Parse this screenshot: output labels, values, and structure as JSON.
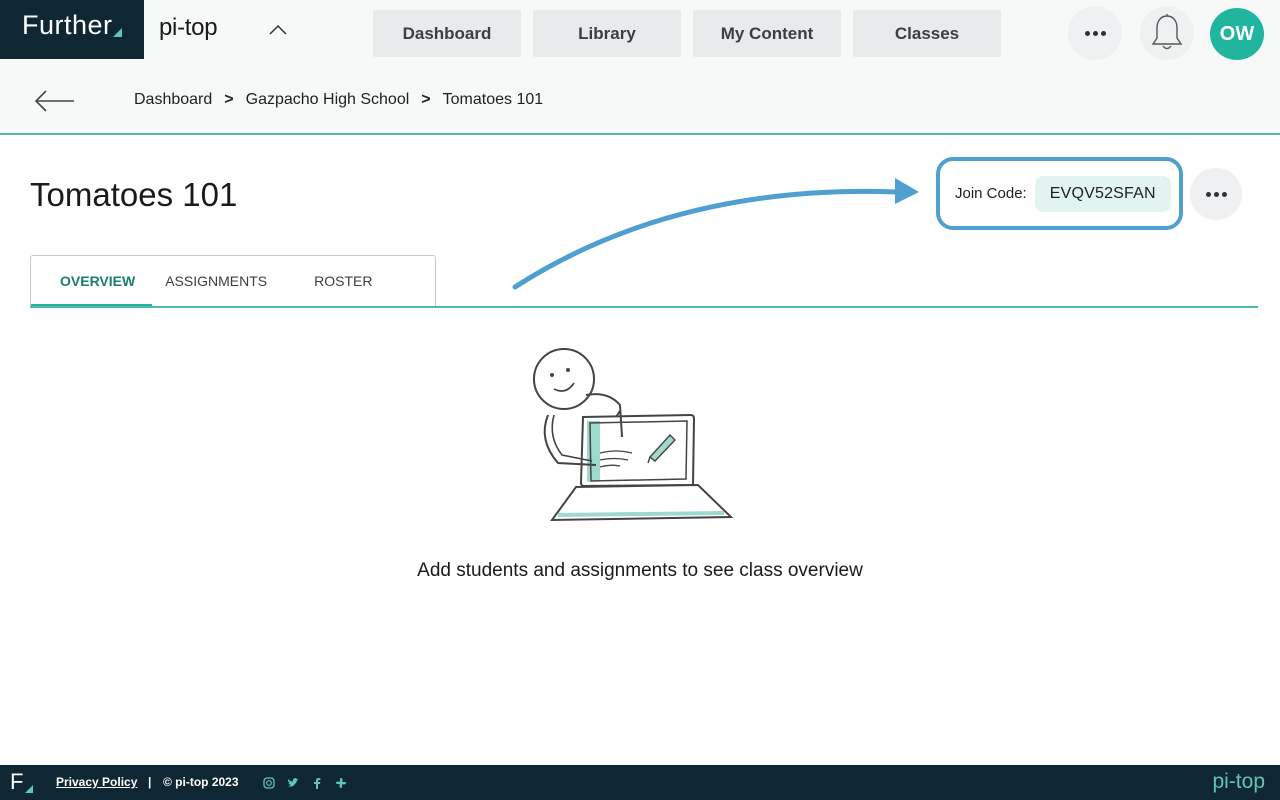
{
  "header": {
    "brand": "Further",
    "org_name": "pi-top",
    "nav": [
      {
        "label": "Dashboard"
      },
      {
        "label": "Library"
      },
      {
        "label": "My Content"
      },
      {
        "label": "Classes"
      }
    ],
    "avatar_initials": "OW"
  },
  "breadcrumb": [
    "Dashboard",
    "Gazpacho High School",
    "Tomatoes 101"
  ],
  "breadcrumb_separator": ">",
  "page": {
    "title": "Tomatoes 101",
    "join_code_label": "Join Code:",
    "join_code": "EVQV52SFAN"
  },
  "tabs": [
    {
      "label": "OVERVIEW",
      "active": true
    },
    {
      "label": "ASSIGNMENTS",
      "active": false
    },
    {
      "label": "ROSTER",
      "active": false
    }
  ],
  "empty_state": {
    "message": "Add students and assignments to see class overview",
    "illustration": "person-with-laptop-illustration"
  },
  "footer": {
    "logo": "F",
    "privacy": "Privacy Policy",
    "separator": "|",
    "copyright": "© pi-top 2023",
    "social_icons": [
      "instagram-icon",
      "twitter-icon",
      "facebook-icon",
      "slack-icon"
    ],
    "brand": "pi-top"
  },
  "colors": {
    "navy": "#0f2633",
    "teal": "#1fb59f",
    "annotation_blue": "#4f9fd1"
  }
}
